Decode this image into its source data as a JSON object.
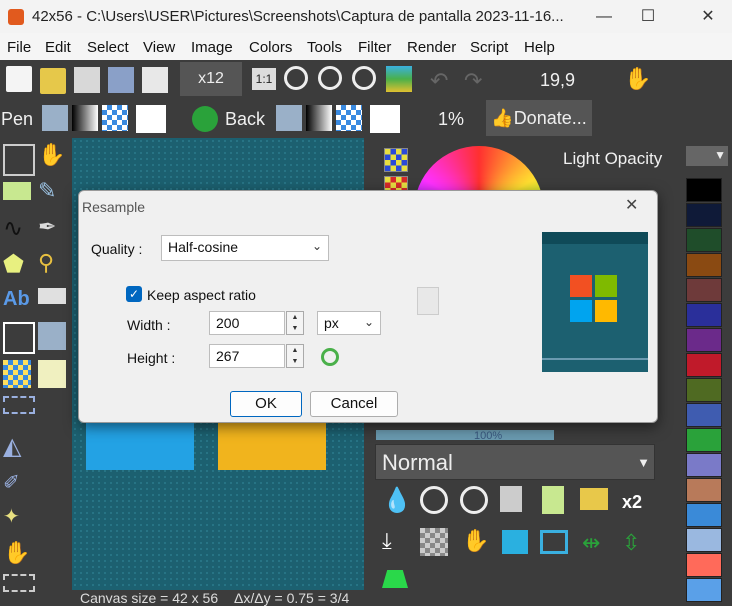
{
  "window": {
    "title": "42x56 - C:\\Users\\USER\\Pictures\\Screenshots\\Captura de pantalla 2023-11-16...",
    "minimize": "—",
    "maximize": "☐",
    "close": "✕"
  },
  "menu": [
    "File",
    "Edit",
    "Select",
    "View",
    "Image",
    "Colors",
    "Tools",
    "Filter",
    "Render",
    "Script",
    "Help"
  ],
  "toolbar": {
    "zoom": "x12",
    "one_to_one": "1:1",
    "coords": "19,9",
    "tool_name": "Pen",
    "back_label": "Back",
    "percent": "1%",
    "donate_label": "Donate..."
  },
  "right_panel": {
    "light_opacity": "Light Opacity",
    "blend_mode": "Normal",
    "zoom_caption": "100%",
    "x2": "x2"
  },
  "status": {
    "canvas_size": "Canvas size = 42 x 56",
    "ratio": "Δx/Δy = 0.75 = 3/4"
  },
  "dialog": {
    "title": "Resample",
    "close": "✕",
    "quality_label": "Quality :",
    "quality_value": "Half-cosine",
    "keep_aspect_label": "Keep aspect ratio",
    "keep_aspect_checked": true,
    "width_label": "Width :",
    "width_value": "200",
    "height_label": "Height :",
    "height_value": "267",
    "unit_value": "px",
    "ok_label": "OK",
    "cancel_label": "Cancel"
  },
  "colors": {
    "canvas": "#1c6070",
    "accent": "#0067c0",
    "palette": [
      "#000000",
      "#0f1a38",
      "#1f4d2a",
      "#8a4a12",
      "#6e3a3a",
      "#2a2f9a",
      "#6b2a8a",
      "#c01a2a",
      "#4f6a22",
      "#3f5cb0",
      "#2aa23a",
      "#7a7ac8",
      "#b87a5a",
      "#3a8ad8",
      "#9ab8e0",
      "#ff6a5a",
      "#5aa0e8"
    ]
  }
}
